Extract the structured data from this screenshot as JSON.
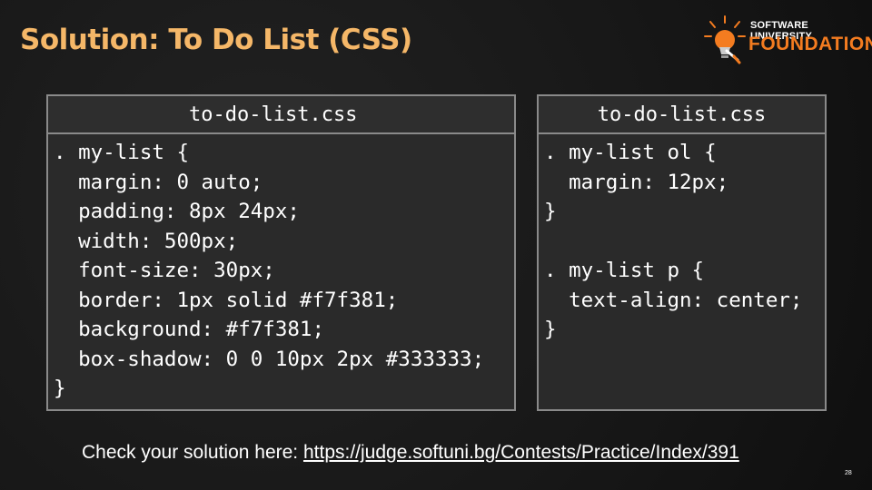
{
  "slide": {
    "title": "Solution: To Do List (CSS)",
    "page_number": "28"
  },
  "logo": {
    "line1": "SOFTWARE UNIVERSITY",
    "line2": "FOUNDATION",
    "icon": "lightbulb-logo-icon",
    "accent_color": "#f47c20"
  },
  "left_panel": {
    "filename": "to-do-list.css",
    "code": ". my-list {\n  margin: 0 auto;\n  padding: 8px 24px;\n  width: 500px;\n  font-size: 30px;\n  border: 1px solid #f7f381;\n  background: #f7f381;\n  box-shadow: 0 0 10px 2px #333333;\n}"
  },
  "right_panel": {
    "filename": "to-do-list.css",
    "code": ". my-list ol {\n  margin: 12px;\n}\n\n. my-list p {\n  text-align: center;\n}"
  },
  "footer": {
    "prefix": "Check your solution here: ",
    "link_text": "https://judge.softuni.bg/Contests/Practice/Index/391"
  },
  "colors": {
    "title": "#f5b768",
    "background": "#171717",
    "panel_border": "#8a8a8a"
  }
}
